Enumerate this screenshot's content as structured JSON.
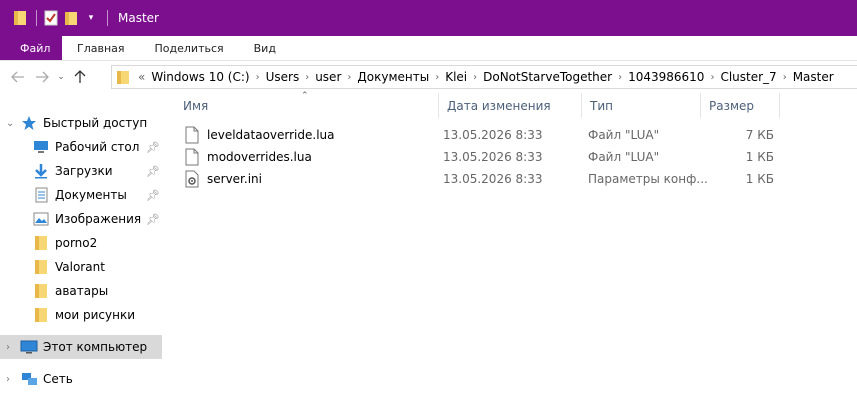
{
  "window": {
    "title": "Master",
    "accent": "#7c0f8e"
  },
  "quick_access_toolbar": {
    "icons": [
      "folder-icon",
      "properties-icon",
      "new-folder-icon",
      "dropdown-icon"
    ]
  },
  "ribbon": {
    "tabs": [
      {
        "label": "Файл"
      },
      {
        "label": "Главная"
      },
      {
        "label": "Поделиться"
      },
      {
        "label": "Вид"
      }
    ]
  },
  "address": {
    "lead": "«",
    "crumbs": [
      "Windows 10 (C:)",
      "Users",
      "user",
      "Документы",
      "Klei",
      "DoNotStarveTogether",
      "1043986610",
      "Cluster_7",
      "Master"
    ]
  },
  "nav": {
    "items": [
      {
        "label": "Быстрый доступ",
        "icon": "star-icon"
      },
      {
        "label": "Рабочий стол",
        "icon": "desktop-icon",
        "pinned": true
      },
      {
        "label": "Загрузки",
        "icon": "download-icon",
        "pinned": true
      },
      {
        "label": "Документы",
        "icon": "documents-icon",
        "pinned": true
      },
      {
        "label": "Изображения",
        "icon": "pictures-icon",
        "pinned": true
      },
      {
        "label": "porno2",
        "icon": "folder-icon"
      },
      {
        "label": "Valorant",
        "icon": "folder-icon"
      },
      {
        "label": "аватары",
        "icon": "folder-icon"
      },
      {
        "label": "мои рисунки",
        "icon": "folder-icon"
      },
      {
        "label": "Этот компьютер",
        "icon": "computer-icon",
        "selected": true
      },
      {
        "label": "Сеть",
        "icon": "network-icon"
      }
    ]
  },
  "columns": {
    "name": "Имя",
    "date": "Дата изменения",
    "type": "Тип",
    "size": "Размер"
  },
  "files": [
    {
      "name": "leveldataoverride.lua",
      "date": "13.05.2026 8:33",
      "type": "Файл \"LUA\"",
      "size": "7 КБ",
      "icon": "file-icon"
    },
    {
      "name": "modoverrides.lua",
      "date": "13.05.2026 8:33",
      "type": "Файл \"LUA\"",
      "size": "1 КБ",
      "icon": "file-icon"
    },
    {
      "name": "server.ini",
      "date": "13.05.2026 8:33",
      "type": "Параметры конф...",
      "size": "1 КБ",
      "icon": "settings-file-icon"
    }
  ]
}
